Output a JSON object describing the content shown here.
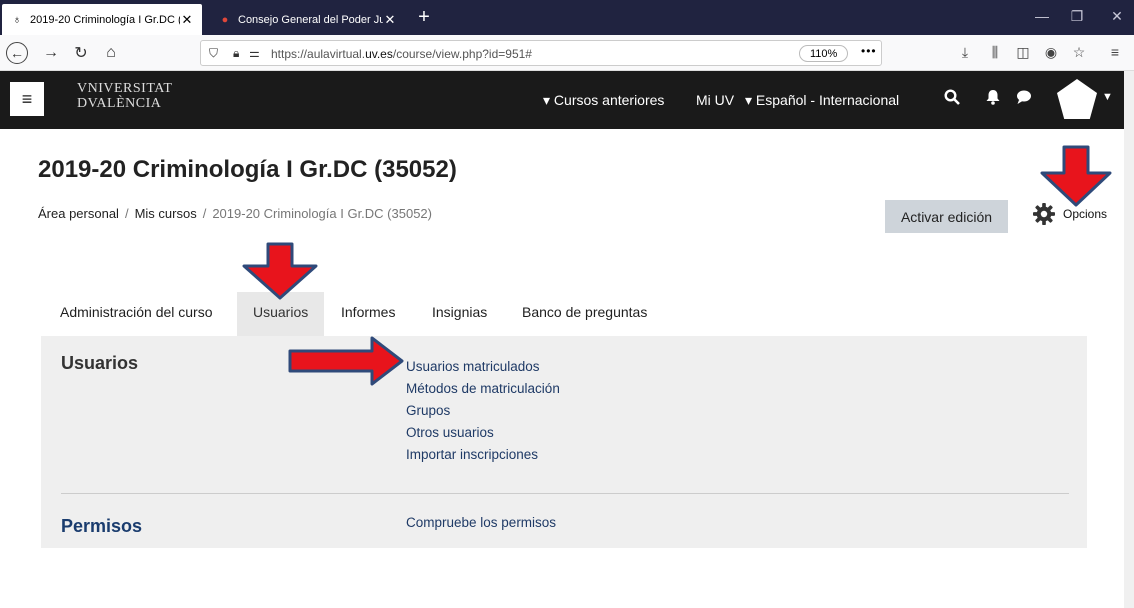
{
  "browser": {
    "tabs": [
      {
        "title": "2019-20 Criminología I Gr.DC (",
        "active": true
      },
      {
        "title": "Consejo General del Poder Judi",
        "active": false
      }
    ],
    "new_tab": "+",
    "url_prefix": "https://aulavirtual.",
    "url_domain": "uv.es",
    "url_rest": "/course/view.php?id=951#",
    "zoom": "110%",
    "more": "•••"
  },
  "header": {
    "logo_line1": "VNIVERSITAT",
    "logo_line2": "DVALÈNCIA",
    "cursos_anteriores": "Cursos anteriores",
    "mi_uv": "Mi UV",
    "idioma": "Español - Internacional"
  },
  "page": {
    "title": "2019-20 Criminología I Gr.DC (35052)",
    "breadcrumb": [
      "Área personal",
      "Mis cursos",
      "2019-20 Criminología I Gr.DC (35052)"
    ],
    "edit_button": "Activar edición",
    "options": "Opcions"
  },
  "course_tabs": [
    "Administración del curso",
    "Usuarios",
    "Informes",
    "Insignias",
    "Banco de preguntas"
  ],
  "sections": {
    "usuarios": {
      "heading": "Usuarios",
      "links": [
        "Usuarios matriculados",
        "Métodos de matriculación",
        "Grupos",
        "Otros usuarios",
        "Importar inscripciones"
      ]
    },
    "permisos": {
      "heading": "Permisos",
      "link": "Compruebe los permisos"
    }
  },
  "colors": {
    "arrow_fill": "#e8141c",
    "arrow_outline": "#2f4a7a",
    "header_bg": "#1a1a1a",
    "link": "#1f3a66"
  }
}
